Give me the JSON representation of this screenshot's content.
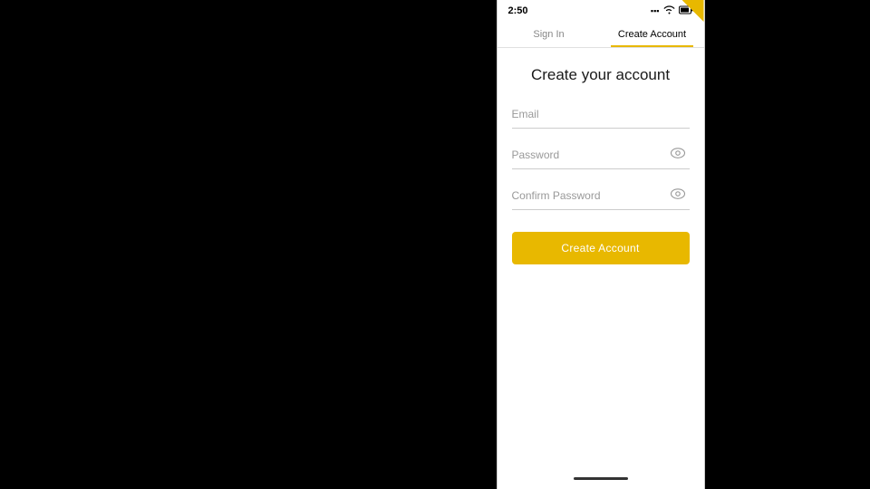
{
  "statusBar": {
    "time": "2:50",
    "wifi": "wifi",
    "signal": "signal",
    "battery": "battery"
  },
  "tabs": [
    {
      "label": "Sign In",
      "active": false
    },
    {
      "label": "Create Account",
      "active": true
    }
  ],
  "form": {
    "title": "Create your account",
    "emailPlaceholder": "Email",
    "passwordPlaceholder": "Password",
    "confirmPasswordPlaceholder": "Confirm Password",
    "submitLabel": "Create Account"
  },
  "colors": {
    "accent": "#e8b800",
    "activeTab": "#000",
    "inactiveTab": "#888"
  }
}
